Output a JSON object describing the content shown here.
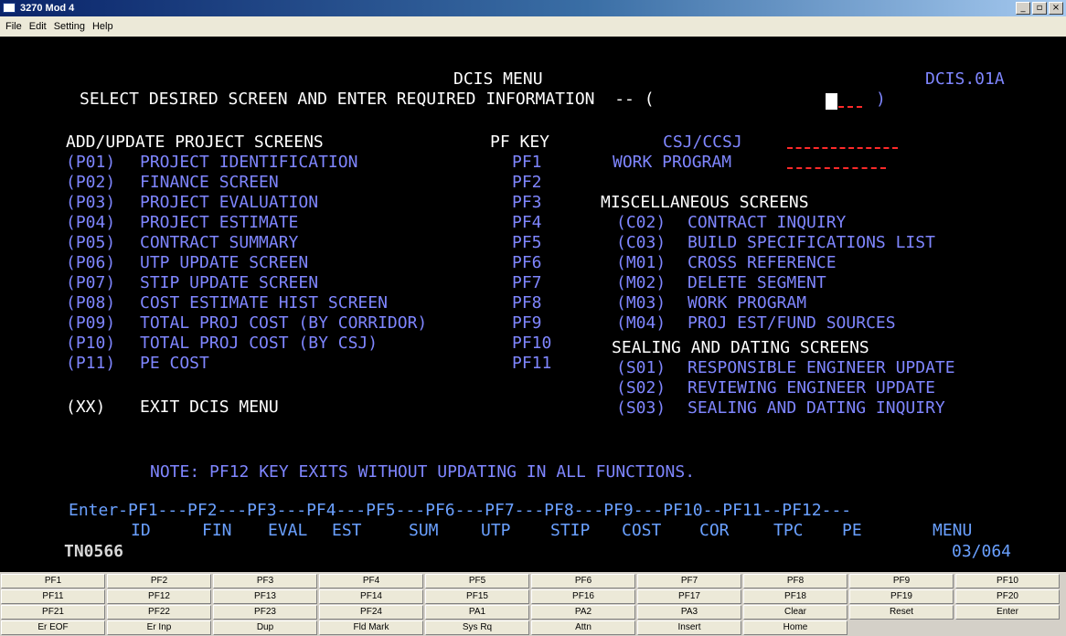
{
  "window": {
    "title": "3270 Mod 4",
    "min_glyph": "_",
    "max_glyph": "▫",
    "close_glyph": "×"
  },
  "menu": [
    "File",
    "Edit",
    "Setting",
    "Help"
  ],
  "screen": {
    "menu_title": "DCIS MENU",
    "screen_id": "DCIS.01A",
    "select_prompt": "SELECT DESIRED SCREEN AND ENTER REQUIRED INFORMATION  -- (",
    "select_close": ")",
    "left_heading": "ADD/UPDATE PROJECT SCREENS",
    "pf_heading": "PF KEY",
    "csj_label": "CSJ/CCSJ",
    "work_program_label": "WORK PROGRAM",
    "project_screens": [
      {
        "code": "(P01)",
        "name": "PROJECT IDENTIFICATION",
        "pf": "PF1"
      },
      {
        "code": "(P02)",
        "name": "FINANCE SCREEN",
        "pf": "PF2"
      },
      {
        "code": "(P03)",
        "name": "PROJECT EVALUATION",
        "pf": "PF3"
      },
      {
        "code": "(P04)",
        "name": "PROJECT ESTIMATE",
        "pf": "PF4"
      },
      {
        "code": "(P05)",
        "name": "CONTRACT SUMMARY",
        "pf": "PF5"
      },
      {
        "code": "(P06)",
        "name": "UTP UPDATE SCREEN",
        "pf": "PF6"
      },
      {
        "code": "(P07)",
        "name": "STIP UPDATE SCREEN",
        "pf": "PF7"
      },
      {
        "code": "(P08)",
        "name": "COST ESTIMATE HIST SCREEN",
        "pf": "PF8"
      },
      {
        "code": "(P09)",
        "name": "TOTAL PROJ COST (BY CORRIDOR)",
        "pf": "PF9"
      },
      {
        "code": "(P10)",
        "name": "TOTAL PROJ COST (BY CSJ)",
        "pf": "PF10"
      },
      {
        "code": "(P11)",
        "name": "PE COST",
        "pf": "PF11"
      }
    ],
    "exit_code": "(XX)",
    "exit_label": "EXIT DCIS MENU",
    "misc_heading": "MISCELLANEOUS SCREENS",
    "misc_screens": [
      {
        "code": "(C02)",
        "name": "CONTRACT INQUIRY"
      },
      {
        "code": "(C03)",
        "name": "BUILD SPECIFICATIONS LIST"
      },
      {
        "code": "(M01)",
        "name": "CROSS REFERENCE"
      },
      {
        "code": "(M02)",
        "name": "DELETE SEGMENT"
      },
      {
        "code": "(M03)",
        "name": "WORK PROGRAM"
      },
      {
        "code": "(M04)",
        "name": "PROJ EST/FUND SOURCES"
      }
    ],
    "sealing_heading": "SEALING AND DATING SCREENS",
    "sealing_screens": [
      {
        "code": "(S01)",
        "name": "RESPONSIBLE ENGINEER UPDATE"
      },
      {
        "code": "(S02)",
        "name": "REVIEWING ENGINEER UPDATE"
      },
      {
        "code": "(S03)",
        "name": "SEALING AND DATING INQUIRY"
      }
    ],
    "note": "NOTE: PF12 KEY EXITS WITHOUT UPDATING IN ALL FUNCTIONS.",
    "pf_bar": "Enter-PF1---PF2---PF3---PF4---PF5---PF6---PF7---PF8---PF9---PF10--PF11--PF12---",
    "pf_labels": [
      "ID",
      "FIN",
      "EVAL",
      "EST",
      "SUM",
      "UTP",
      "STIP",
      "COST",
      "COR",
      "TPC",
      "PE",
      "MENU"
    ],
    "terminal_id": "TN0566",
    "cursor_pos": "03/064"
  },
  "keypad": [
    [
      "PF1",
      "PF2",
      "PF3",
      "PF4",
      "PF5",
      "PF6",
      "PF7",
      "PF8",
      "PF9",
      "PF10"
    ],
    [
      "PF11",
      "PF12",
      "PF13",
      "PF14",
      "PF15",
      "PF16",
      "PF17",
      "PF18",
      "PF19",
      "PF20"
    ],
    [
      "PF21",
      "PF22",
      "PF23",
      "PF24",
      "PA1",
      "PA2",
      "PA3",
      "Clear",
      "Reset",
      "Enter"
    ],
    [
      "Er EOF",
      "Er Inp",
      "Dup",
      "Fld Mark",
      "Sys Rq",
      "Attn",
      "Insert",
      "Home"
    ]
  ]
}
